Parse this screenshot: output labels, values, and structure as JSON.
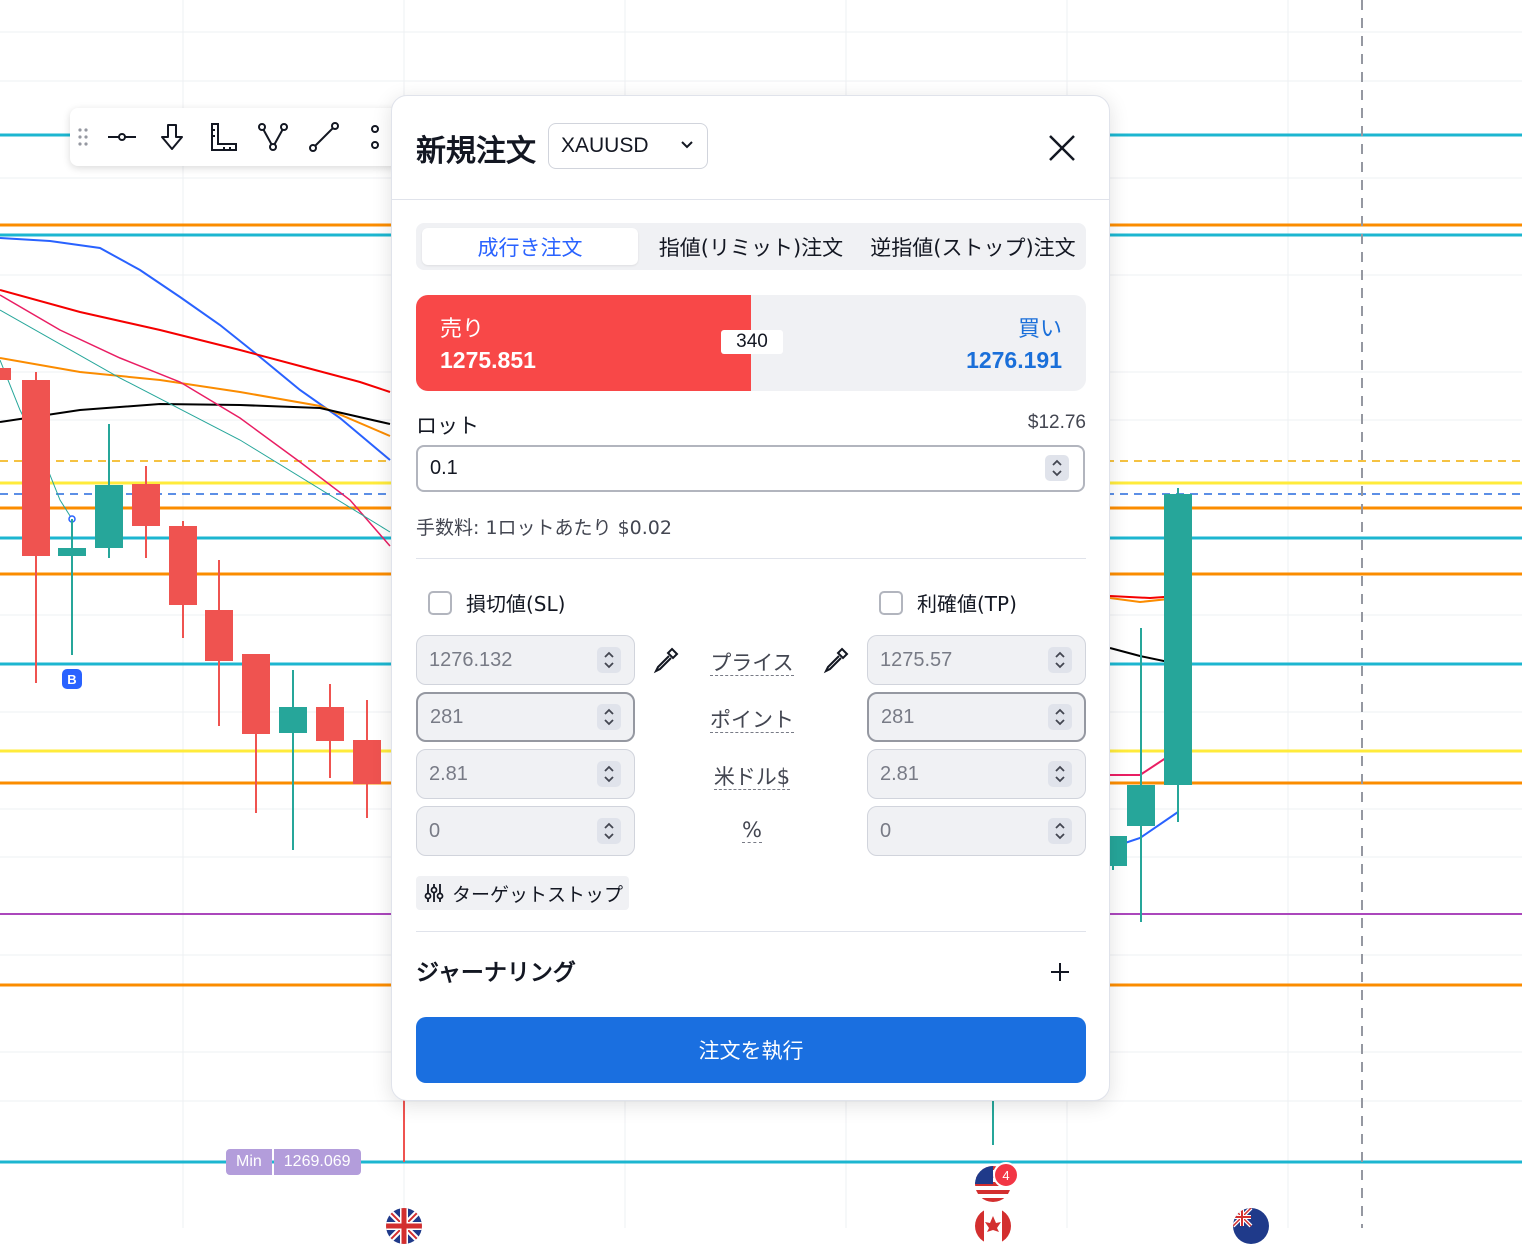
{
  "chart": {
    "min_label": "Min",
    "min_value": "1269.069",
    "trade_marker": "B",
    "event_count": "4"
  },
  "drawing_toolbar": {
    "tools": [
      "horizontal-line-icon",
      "arrow-down-icon",
      "ruler-icon",
      "pattern-icon",
      "trend-line-icon",
      "more-tools-icon"
    ]
  },
  "order_dialog": {
    "title": "新規注文",
    "symbol": "XAUUSD",
    "tabs": [
      "成行き注文",
      "指値(リミット)注文",
      "逆指値(ストップ)注文"
    ],
    "active_tab": "成行き注文",
    "sell": {
      "label": "売り",
      "price": "1275.851"
    },
    "buy": {
      "label": "買い",
      "price": "1276.191"
    },
    "spread": "340",
    "lot": {
      "label": "ロット",
      "amount": "$12.76",
      "value": "0.1"
    },
    "commission": "手数料: 1ロットあたり $0.02",
    "stop_loss": {
      "label": "損切値(SL)",
      "checked": false,
      "price": "1276.132",
      "points": "281",
      "usd": "2.81",
      "percent": "0"
    },
    "take_profit": {
      "label": "利確値(TP)",
      "checked": false,
      "price": "1275.57",
      "points": "281",
      "usd": "2.81",
      "percent": "0"
    },
    "row_labels": {
      "price": "プライス",
      "points": "ポイント",
      "usd": "米ドル$",
      "percent": "%"
    },
    "target_stop_label": "ターゲットストップ",
    "journaling_label": "ジャーナリング",
    "submit_label": "注文を執行"
  },
  "colors": {
    "sell": "#f84848",
    "buy": "#1a6fd9",
    "submit": "#1a6fe0",
    "candle_up": "#26a69a",
    "candle_down": "#ef5350"
  }
}
